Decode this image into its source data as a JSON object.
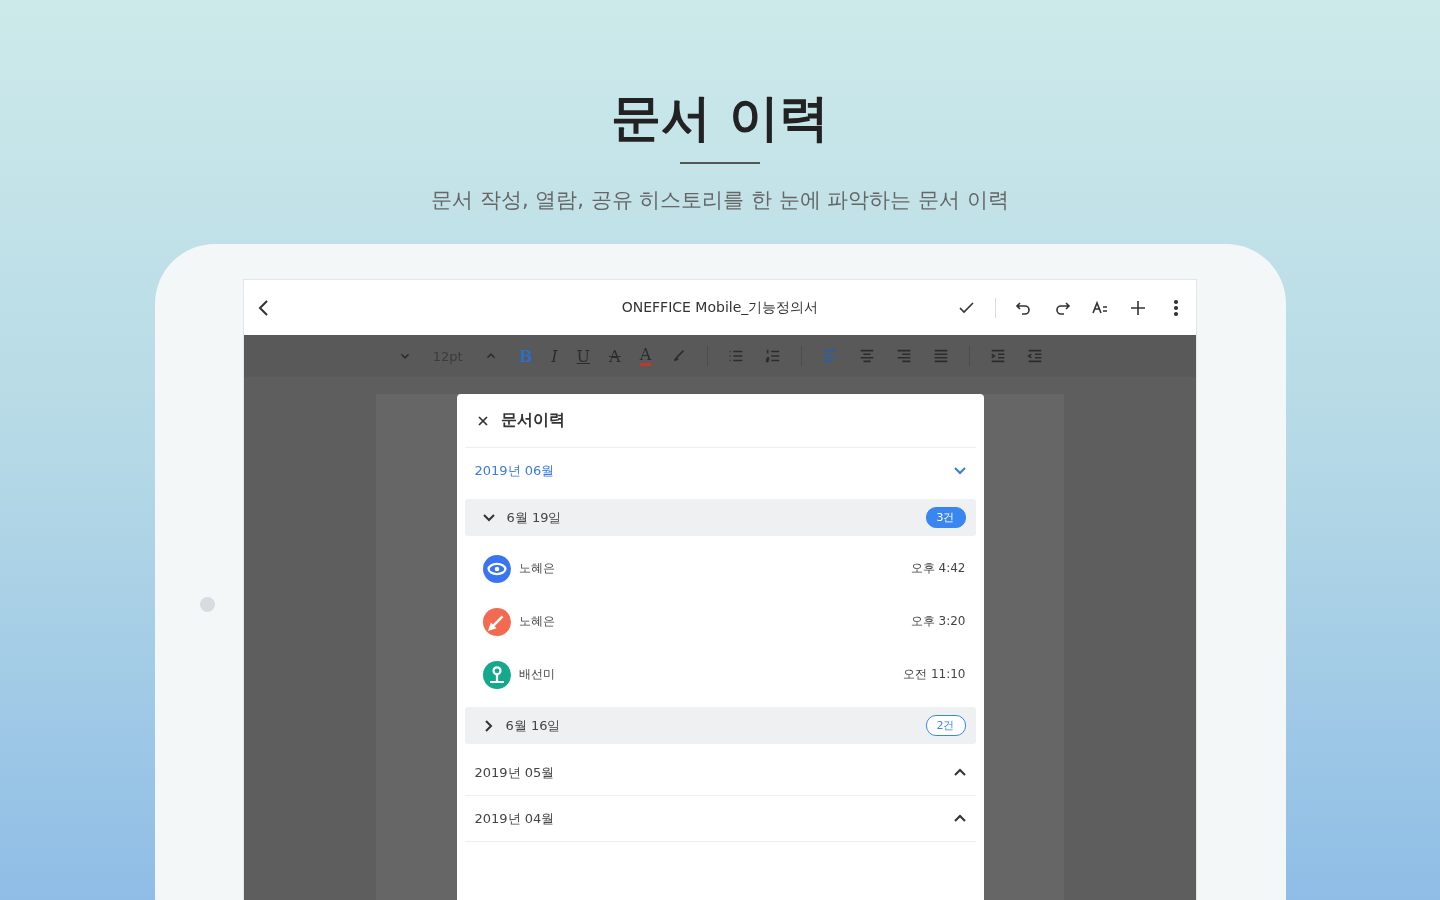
{
  "headline": "문서 이력",
  "subtitle": "문서 작성, 열람, 공유 히스토리를 한 눈에 파악하는 문서 이력",
  "app_bar": {
    "title": "ONEFFICE Mobile_기능정의서"
  },
  "toolbar": [
    {
      "kind": "down"
    },
    {
      "kind": "size",
      "label": "12pt"
    },
    {
      "kind": "up"
    },
    {
      "kind": "bold",
      "label": "B",
      "selected": true
    },
    {
      "kind": "italic",
      "label": "I",
      "selected": false
    },
    {
      "kind": "underline",
      "label": "U",
      "selected": false
    },
    {
      "kind": "strike",
      "label": "A",
      "selected": false
    },
    {
      "kind": "color",
      "label": "A",
      "selected": false
    },
    {
      "kind": "brush"
    },
    {
      "kind": "sep"
    },
    {
      "kind": "bullets"
    },
    {
      "kind": "numbers"
    },
    {
      "kind": "sep"
    },
    {
      "kind": "align-left",
      "selected": true
    },
    {
      "kind": "align-center",
      "selected": false
    },
    {
      "kind": "align-right",
      "selected": false
    },
    {
      "kind": "justify",
      "selected": false
    },
    {
      "kind": "sep"
    },
    {
      "kind": "indent"
    },
    {
      "kind": "outdent"
    }
  ],
  "history_panel": {
    "title": "문서이력",
    "months": [
      {
        "label": "2019년 06월",
        "expanded": true,
        "days": [
          {
            "label": "6월 19일",
            "count": "3건",
            "expanded": true,
            "entries": [
              {
                "kind": "view",
                "color": "#3b74f0",
                "name": "노혜은",
                "time": "오후 4:42"
              },
              {
                "kind": "edit",
                "color": "#f26b50",
                "name": "노혜은",
                "time": "오후 3:20"
              },
              {
                "kind": "share",
                "color": "#16a88a",
                "name": "배선미",
                "time": "오전 11:10"
              }
            ]
          },
          {
            "label": "6월 16일",
            "count": "2건",
            "expanded": false
          }
        ]
      },
      {
        "label": "2019년 05월",
        "expanded": false
      },
      {
        "label": "2019년 04월",
        "expanded": false
      }
    ]
  }
}
